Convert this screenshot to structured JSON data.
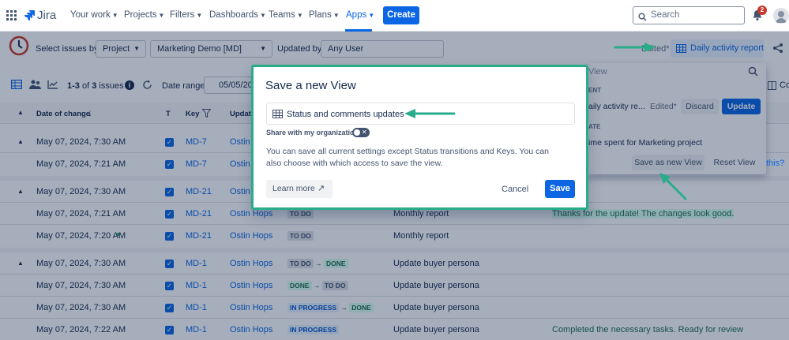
{
  "nav": {
    "logo_text": "Jira",
    "items": [
      {
        "label": "Your work"
      },
      {
        "label": "Projects"
      },
      {
        "label": "Filters"
      },
      {
        "label": "Dashboards"
      },
      {
        "label": "Teams"
      },
      {
        "label": "Plans"
      },
      {
        "label": "Apps"
      }
    ],
    "create_label": "Create",
    "search_placeholder": "Search",
    "notification_count": "2"
  },
  "toolbar": {
    "select_issues_label": "Select issues by:",
    "select_by_value": "Project",
    "project_value": "Marketing Demo [MD]",
    "updated_by_label": "Updated by:",
    "updated_by_value": "Any User",
    "edited_label": "Edited*",
    "report_label": "Daily activity report",
    "issues_count_prefix": "1-3",
    "issues_count_mid": "of",
    "issues_count_total": "3",
    "issues_count_suffix": "issues",
    "date_range_label": "Date range:",
    "date_range_value": "05/05/20",
    "columns_partial": "Co"
  },
  "table": {
    "headers": {
      "date": "Date of change",
      "t": "T",
      "key": "Key",
      "updated": "Update"
    },
    "groups": [
      {
        "rows": [
          {
            "date": "May 07, 2024, 7:30 AM",
            "key": "MD-7",
            "user": "Ostin H"
          },
          {
            "date": "May 07, 2024, 7:21 AM",
            "key": "MD-7",
            "user": "Ostin H"
          }
        ]
      },
      {
        "rows": [
          {
            "date": "May 07, 2024, 7:30 AM",
            "key": "MD-21",
            "user": "Ostin H"
          },
          {
            "date": "May 07, 2024, 7:21 AM",
            "key": "MD-21",
            "user": "Ostin Hops",
            "status_from": "TO DO",
            "summary": "Monthly report",
            "comment": "Thanks for the update! The changes look good."
          },
          {
            "date": "May 07, 2024, 7:20 AM",
            "key": "MD-21",
            "user": "Ostin Hops",
            "status_from": "TO DO",
            "summary": "Monthly report"
          }
        ]
      },
      {
        "rows": [
          {
            "date": "May 07, 2024, 7:30 AM",
            "key": "MD-1",
            "user": "Ostin Hops",
            "status_from": "TO DO",
            "status_to": "DONE",
            "summary": "Update buyer persona"
          },
          {
            "date": "May 07, 2024, 7:30 AM",
            "key": "MD-1",
            "user": "Ostin Hops",
            "status_from": "DONE",
            "status_to": "TO DO",
            "summary": "Update buyer persona"
          },
          {
            "date": "May 07, 2024, 7:30 AM",
            "key": "MD-1",
            "user": "Ostin Hops",
            "status_from": "IN PROGRESS",
            "status_to": "DONE",
            "summary": "Update buyer persona"
          },
          {
            "date": "May 07, 2024, 7:22 AM",
            "key": "MD-1",
            "user": "Ostin Hops",
            "status_from": "IN PROGRESS",
            "summary": "Update buyer persona",
            "comment": "Completed the necessary tasks. Ready for review"
          }
        ]
      }
    ]
  },
  "dropdown": {
    "search_partial": "View",
    "current_section": "ENT",
    "current_view": "aily activity re...",
    "edited": "Edited*",
    "discard_label": "Discard",
    "update_label": "Update",
    "template_section": "ATE",
    "template_item": "ime spent for Marketing project",
    "save_new_label": "Save as new View",
    "reset_label": "Reset View",
    "partial_right": "this?"
  },
  "modal": {
    "title": "Save a new View",
    "name_value": "Status and comments updates",
    "share_label": "Share with my organization",
    "description": "You can save all current settings except Status transitions and Keys. You can also choose with which access to save the view.",
    "learn_more_label": "Learn more",
    "cancel_label": "Cancel",
    "save_label": "Save"
  },
  "colors": {
    "primary": "#0c66e4",
    "arrow": "#29ac8a",
    "done": "#216e4e"
  }
}
